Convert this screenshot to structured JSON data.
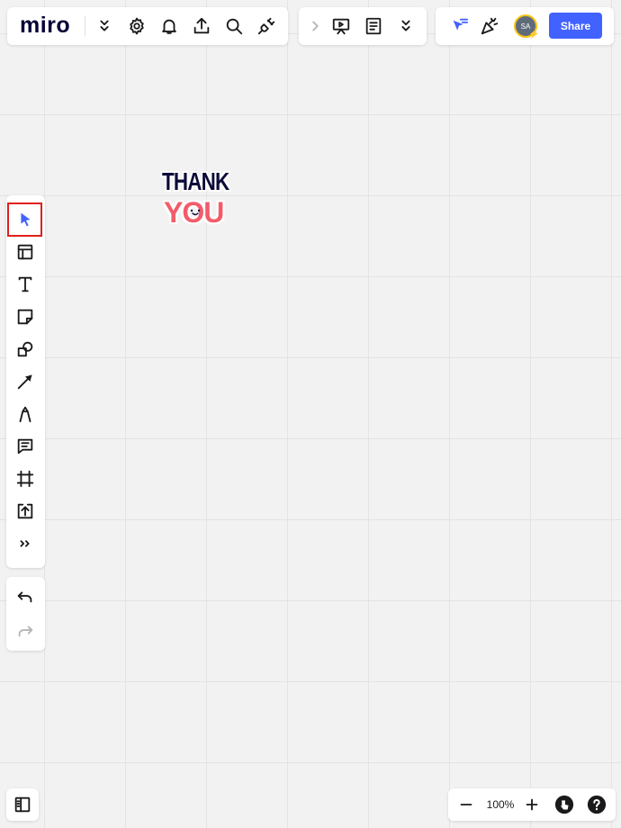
{
  "header": {
    "logo": "miro",
    "share_label": "Share",
    "avatar_initials": "SA",
    "accent_color": "#4262ff"
  },
  "sticker": {
    "line1": "THANK",
    "line2": "YOU"
  },
  "toolbar": {
    "tools": [
      "select-icon",
      "templates-icon",
      "text-icon",
      "sticky-note-icon",
      "shapes-icon",
      "connection-line-icon",
      "pen-icon",
      "comment-icon",
      "frame-icon",
      "upload-icon",
      "more-tools-icon"
    ],
    "selected": "select-icon"
  },
  "zoom": {
    "level": "100%"
  }
}
